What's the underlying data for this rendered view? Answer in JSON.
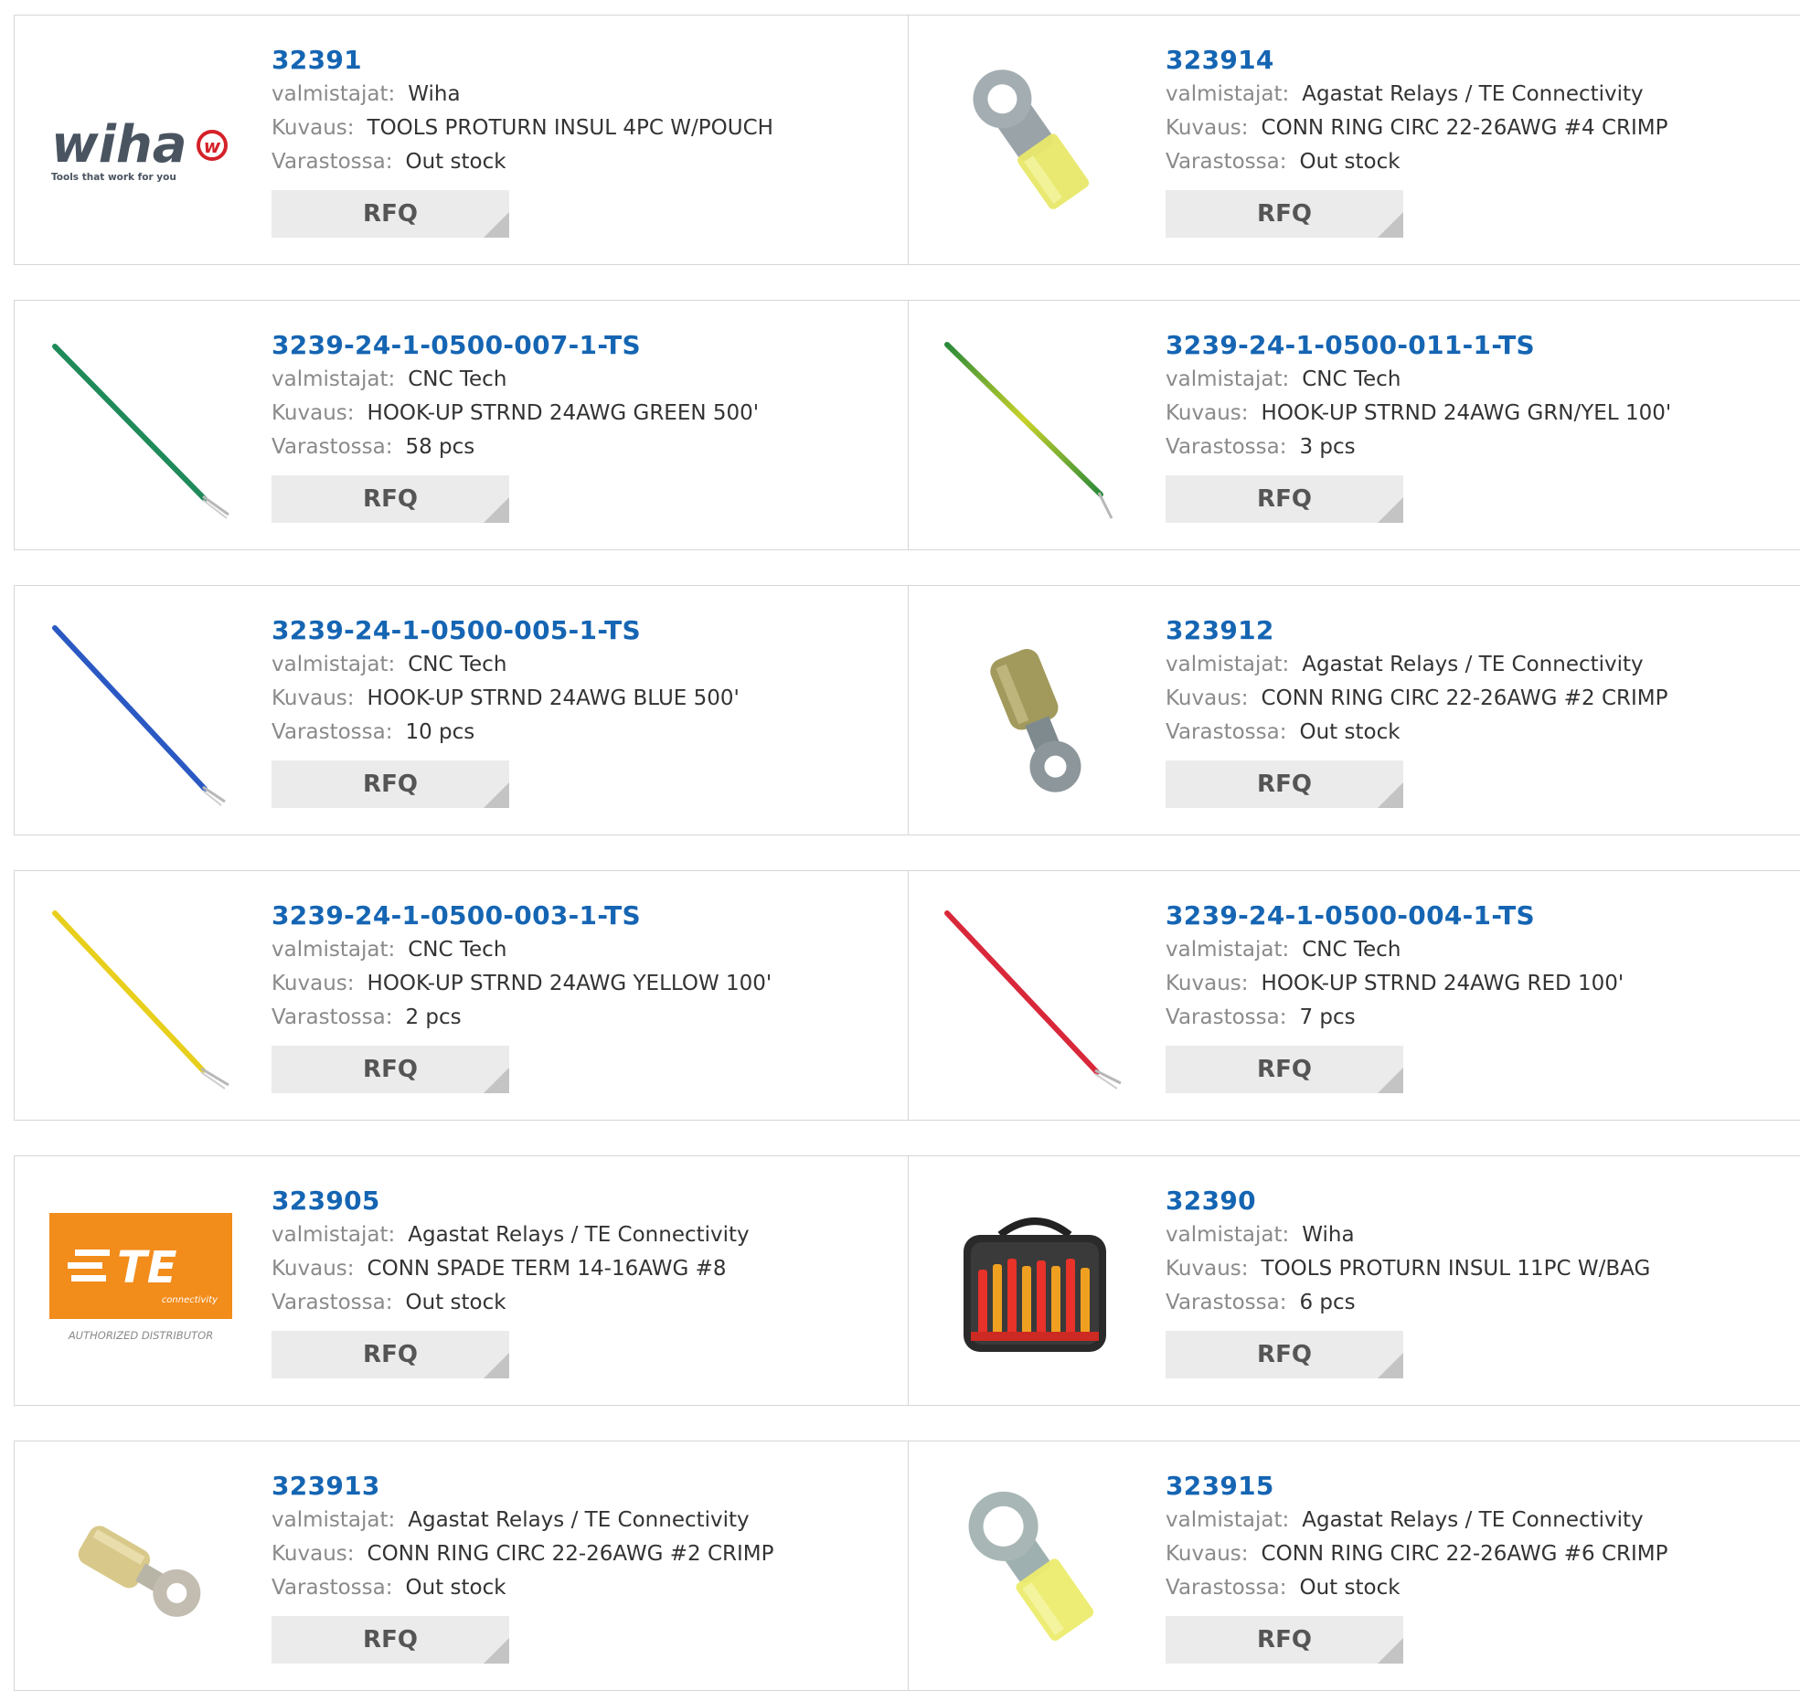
{
  "labels": {
    "manufacturer": "valmistajat:",
    "description": "Kuvaus:",
    "stock": "Varastossa:",
    "rfq": "RFQ"
  },
  "logos": {
    "wiha_name": "wiha",
    "wiha_tagline": "Tools that work for you",
    "te_name": "TE",
    "te_sub": "connectivity",
    "te_footer": "AUTHORIZED DISTRIBUTOR"
  },
  "products": [
    {
      "part": "32391",
      "manufacturer": "Wiha",
      "description": "TOOLS PROTURN INSUL 4PC W/POUCH",
      "stock": "Out stock",
      "image": "wiha-logo"
    },
    {
      "part": "323914",
      "manufacturer": "Agastat Relays / TE Connectivity",
      "description": "CONN RING CIRC 22-26AWG #4 CRIMP",
      "stock": "Out stock",
      "image": "ring-terminal-yellow"
    },
    {
      "part": "3239-24-1-0500-007-1-TS",
      "manufacturer": "CNC Tech",
      "description": "HOOK-UP STRND 24AWG GREEN 500'",
      "stock": "58 pcs",
      "image": "wire-green",
      "color": "#1f8a5a"
    },
    {
      "part": "3239-24-1-0500-011-1-TS",
      "manufacturer": "CNC Tech",
      "description": "HOOK-UP STRND 24AWG GRN/YEL 100'",
      "stock": "3 pcs",
      "image": "wire-green-yellow",
      "color": "#6aa82a"
    },
    {
      "part": "3239-24-1-0500-005-1-TS",
      "manufacturer": "CNC Tech",
      "description": "HOOK-UP STRND 24AWG BLUE 500'",
      "stock": "10 pcs",
      "image": "wire-blue",
      "color": "#2b59c3"
    },
    {
      "part": "323912",
      "manufacturer": "Agastat Relays / TE Connectivity",
      "description": "CONN RING CIRC 22-26AWG #2 CRIMP",
      "stock": "Out stock",
      "image": "ring-terminal-tan"
    },
    {
      "part": "3239-24-1-0500-003-1-TS",
      "manufacturer": "CNC Tech",
      "description": "HOOK-UP STRND 24AWG YELLOW 100'",
      "stock": "2 pcs",
      "image": "wire-yellow",
      "color": "#e8cf1c"
    },
    {
      "part": "3239-24-1-0500-004-1-TS",
      "manufacturer": "CNC Tech",
      "description": "HOOK-UP STRND 24AWG RED 100'",
      "stock": "7 pcs",
      "image": "wire-red",
      "color": "#d8283a"
    },
    {
      "part": "323905",
      "manufacturer": "Agastat Relays / TE Connectivity",
      "description": "CONN SPADE TERM 14-16AWG #8",
      "stock": "Out stock",
      "image": "te-logo"
    },
    {
      "part": "32390",
      "manufacturer": "Wiha",
      "description": "TOOLS PROTURN INSUL 11PC W/BAG",
      "stock": "6 pcs",
      "image": "tool-bag"
    },
    {
      "part": "323913",
      "manufacturer": "Agastat Relays / TE Connectivity",
      "description": "CONN RING CIRC 22-26AWG #2 CRIMP",
      "stock": "Out stock",
      "image": "ring-terminal-small"
    },
    {
      "part": "323915",
      "manufacturer": "Agastat Relays / TE Connectivity",
      "description": "CONN RING CIRC 22-26AWG #6 CRIMP",
      "stock": "Out stock",
      "image": "ring-terminal-yellow-large"
    }
  ],
  "colors": {
    "link": "#1565b3",
    "label": "#8a8a8a",
    "value": "#333333",
    "button_bg": "#ebebeb",
    "border": "#d6d6d6",
    "te_orange": "#f28c1b",
    "wiha_red": "#d4212a"
  }
}
